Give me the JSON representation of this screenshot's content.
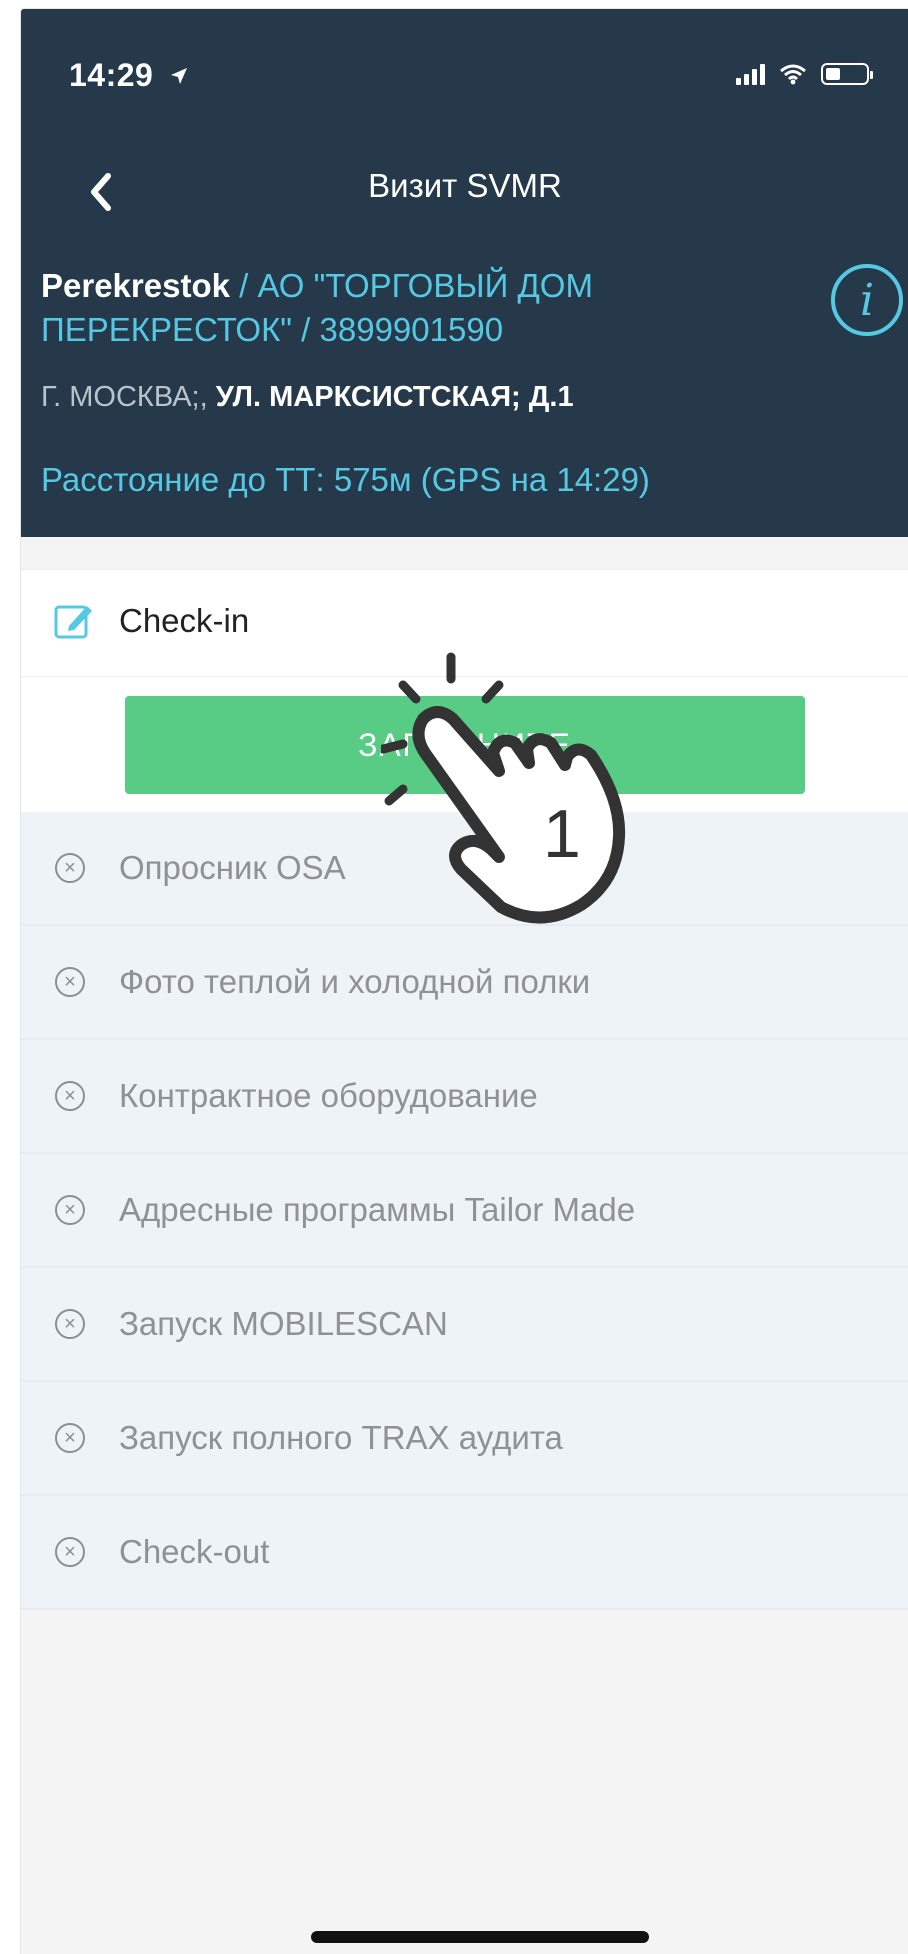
{
  "status_bar": {
    "time": "14:29"
  },
  "header": {
    "title": "Визит SVMR",
    "shop_name": "Perekrestok",
    "shop_details": " / АО \"ТОРГОВЫЙ ДОМ ПЕРЕКРЕСТОК\" / 3899901590",
    "address_city": "Г. МОСКВА;, ",
    "address_street": "УЛ. МАРКСИСТСКАЯ; Д.1",
    "distance": "Расстояние до ТТ: 575м (GPS на 14:29)"
  },
  "checkin": {
    "label": "Check-in",
    "button_label": "ЗАПОЛНИТЕ"
  },
  "tasks": [
    {
      "label": "Опросник OSA"
    },
    {
      "label": "Фото теплой и холодной полки"
    },
    {
      "label": "Контрактное оборудование"
    },
    {
      "label": "Адресные программы Tailor Made"
    },
    {
      "label": "Запуск MOBILESCAN"
    },
    {
      "label": "Запуск полного TRAX аудита"
    },
    {
      "label": "Check-out"
    }
  ],
  "tap_hint": {
    "step_number": "1"
  },
  "icons": {
    "back": "chevron-left-icon",
    "info": "info-icon",
    "checkin": "edit-icon",
    "task_status": "circle-x-icon"
  },
  "colors": {
    "header_bg": "#26394a",
    "accent_blue": "#55c9e3",
    "button_green": "#58cc84",
    "list_bg": "#eef3f8"
  }
}
